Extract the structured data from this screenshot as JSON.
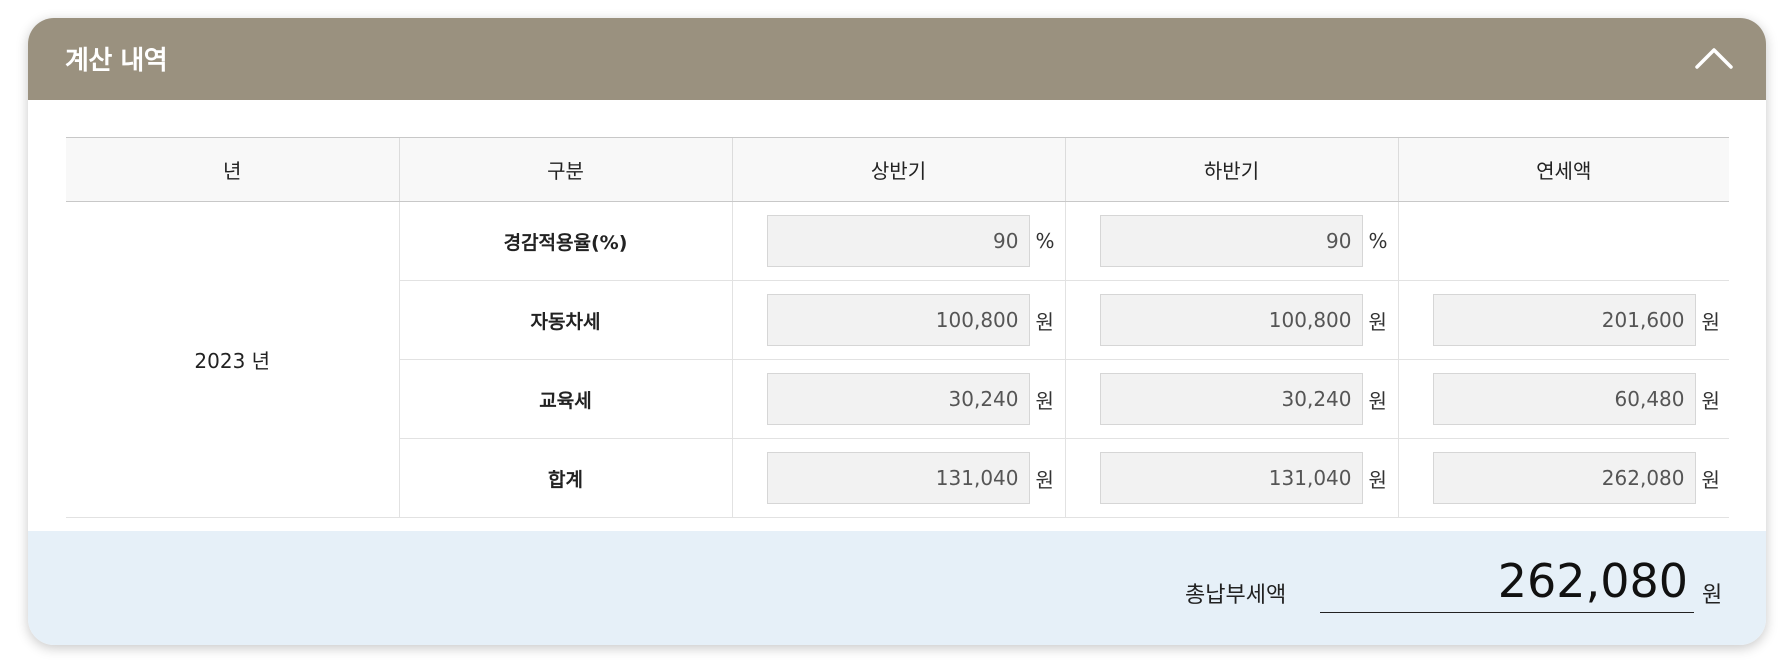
{
  "panel": {
    "title": "계산 내역",
    "collapse_icon": "chevron-up-icon"
  },
  "table": {
    "headers": [
      "년",
      "구분",
      "상반기",
      "하반기",
      "연세액"
    ],
    "year": "2023 년",
    "rows": [
      {
        "label": "경감적용율(%)",
        "h1": "90",
        "h1_unit": "%",
        "h2": "90",
        "h2_unit": "%",
        "annual": "",
        "annual_unit": ""
      },
      {
        "label": "자동차세",
        "h1": "100,800",
        "h1_unit": "원",
        "h2": "100,800",
        "h2_unit": "원",
        "annual": "201,600",
        "annual_unit": "원"
      },
      {
        "label": "교육세",
        "h1": "30,240",
        "h1_unit": "원",
        "h2": "30,240",
        "h2_unit": "원",
        "annual": "60,480",
        "annual_unit": "원"
      },
      {
        "label": "합계",
        "h1": "131,040",
        "h1_unit": "원",
        "h2": "131,040",
        "h2_unit": "원",
        "annual": "262,080",
        "annual_unit": "원"
      }
    ]
  },
  "total": {
    "label": "총납부세액",
    "value": "262,080",
    "unit": "원"
  },
  "colors": {
    "header_bg": "#9a917f",
    "footer_bg": "#e6f0f8",
    "input_bg": "#f2f2f2"
  }
}
